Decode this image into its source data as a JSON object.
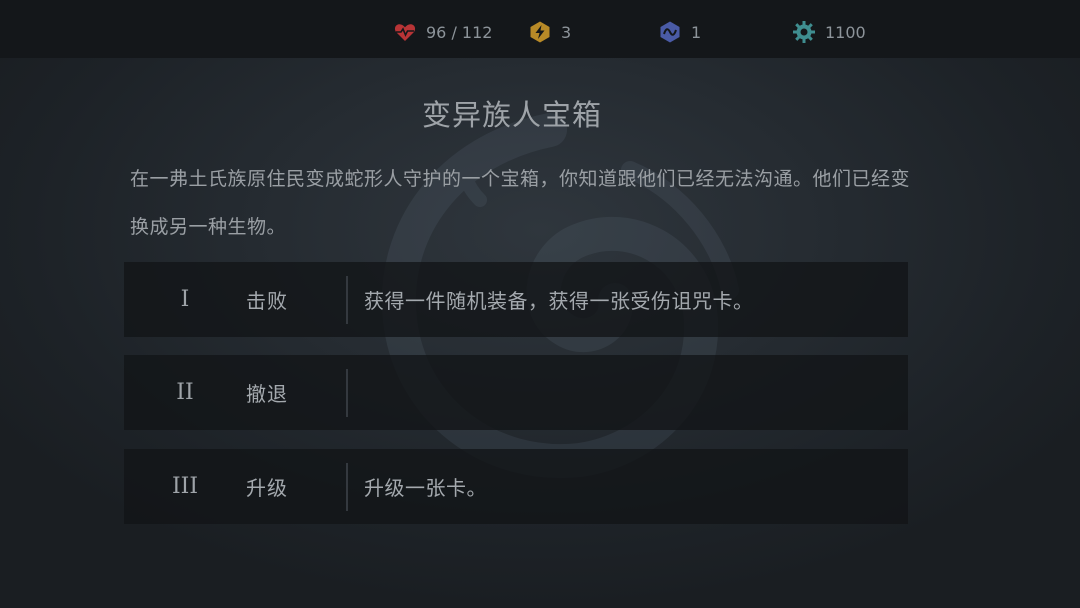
{
  "hud": {
    "health": {
      "icon": "heart-pulse-icon",
      "value": "96 / 112",
      "color": "#c0393b"
    },
    "energy": {
      "icon": "lightning-hexagon-icon",
      "value": "3",
      "color": "#c99a2e"
    },
    "mana": {
      "icon": "wave-hexagon-icon",
      "value": "1",
      "color": "#5468b8"
    },
    "gold": {
      "icon": "gear-coin-icon",
      "value": "1100",
      "color": "#4a9a9c"
    }
  },
  "event": {
    "title": "变异族人宝箱",
    "description": "在一弗土氏族原住民变成蛇形人守护的一个宝箱，你知道跟他们已经无法沟通。他们已经变换成另一种生物。"
  },
  "options": [
    {
      "numeral": "I",
      "action": "击败",
      "effect": "获得一件随机装备，获得一张受伤诅咒卡。"
    },
    {
      "numeral": "II",
      "action": "撤退",
      "effect": ""
    },
    {
      "numeral": "III",
      "action": "升级",
      "effect": "升级一张卡。"
    }
  ],
  "colors": {
    "background": "#1e2328",
    "topbar": "#14171a",
    "option_panel": "#121417",
    "text": "#a4a9ae"
  }
}
